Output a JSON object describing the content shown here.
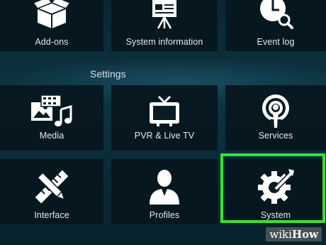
{
  "section_title": "Settings",
  "tiles": {
    "addons": {
      "label": "Add-ons",
      "icon": "box-icon"
    },
    "system_information": {
      "label": "System information",
      "icon": "presentation-easel-icon"
    },
    "event_log": {
      "label": "Event log",
      "icon": "clock-search-icon"
    },
    "media": {
      "label": "Media",
      "icon": "media-icon"
    },
    "pvr": {
      "label": "PVR & Live TV",
      "icon": "tv-icon"
    },
    "services": {
      "label": "Services",
      "icon": "broadcast-icon"
    },
    "interface": {
      "label": "Interface",
      "icon": "pencil-ruler-icon"
    },
    "profiles": {
      "label": "Profiles",
      "icon": "person-icon"
    },
    "system": {
      "label": "System",
      "icon": "gear-wrench-icon"
    }
  },
  "highlight_color": "#39e22a",
  "watermark": {
    "part1": "wiki",
    "part2": "How"
  }
}
